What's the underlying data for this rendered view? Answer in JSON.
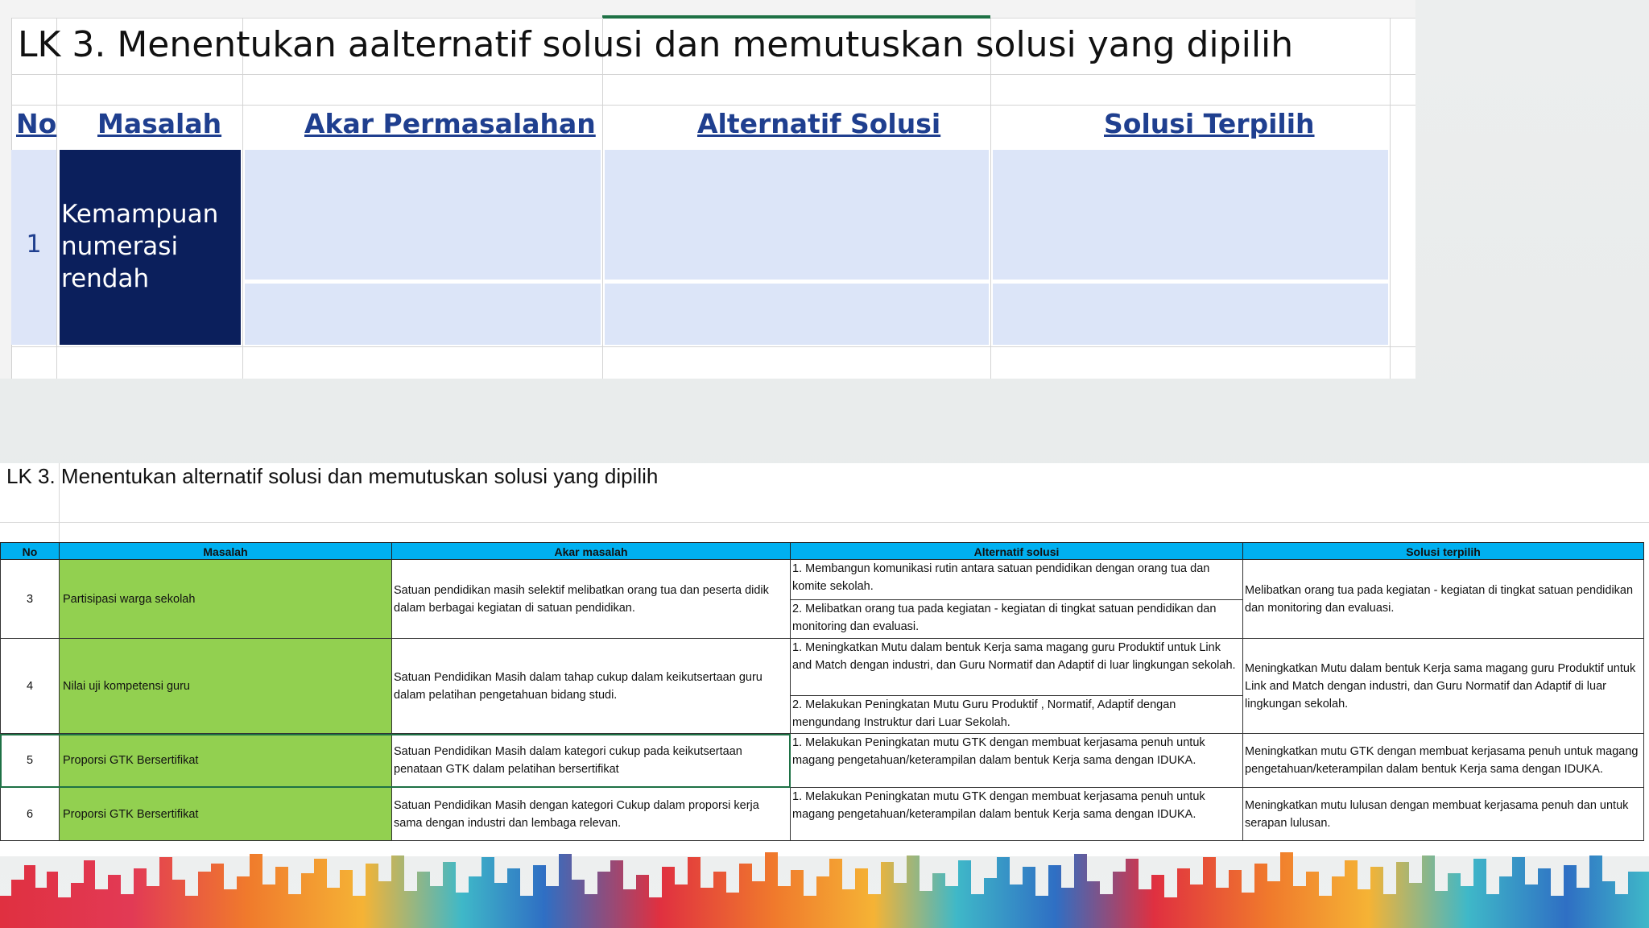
{
  "top_sheet": {
    "title": "LK 3. Menentukan aalternatif solusi dan memutuskan solusi yang dipilih",
    "headers": {
      "no": "No",
      "masalah": "Masalah",
      "akar": "Akar Permasalahan",
      "alternatif": "Alternatif Solusi",
      "terpilih": "Solusi Terpilih"
    },
    "row": {
      "no": "1",
      "masalah": "Kemampuan numerasi rendah"
    }
  },
  "bottom_sheet": {
    "title": "LK 3. Menentukan alternatif solusi dan memutuskan solusi yang dipilih",
    "headers": {
      "no": "No",
      "masalah": "Masalah",
      "akar": "Akar masalah",
      "alternatif": "Alternatif solusi",
      "terpilih": "Solusi terpilih"
    },
    "rows": [
      {
        "no": "3",
        "masalah": "Partisipasi warga sekolah",
        "akar": "Satuan pendidikan masih selektif melibatkan orang tua dan peserta didik dalam berbagai kegiatan di satuan pendidikan.",
        "alternatif": [
          "1. Membangun komunikasi rutin antara satuan pendidikan dengan orang tua dan komite sekolah.",
          "2. Melibatkan orang tua pada kegiatan - kegiatan di tingkat satuan pendidikan dan monitoring dan evaluasi."
        ],
        "terpilih": "Melibatkan orang tua pada kegiatan - kegiatan di tingkat satuan pendidikan dan monitoring dan evaluasi."
      },
      {
        "no": "4",
        "masalah": "Nilai uji kompetensi guru",
        "akar": "Satuan Pendidikan Masih dalam tahap cukup dalam keikutsertaan guru dalam pelatihan pengetahuan bidang studi.",
        "alternatif": [
          "1. Meningkatkan Mutu dalam bentuk Kerja sama magang guru Produktif untuk Link and Match dengan industri, dan Guru Normatif dan Adaptif di luar lingkungan sekolah.",
          "2. Melakukan Peningkatan Mutu Guru Produktif , Normatif, Adaptif dengan mengundang Instruktur dari Luar Sekolah."
        ],
        "terpilih": "Meningkatkan Mutu dalam bentuk Kerja sama magang guru Produktif untuk Link and Match dengan industri, dan Guru Normatif dan Adaptif di luar lingkungan sekolah."
      },
      {
        "no": "5",
        "masalah": "Proporsi GTK Bersertifikat",
        "akar": "Satuan Pendidikan Masih dalam kategori cukup pada keikutsertaan penataan GTK dalam pelatihan bersertifikat",
        "alternatif": [
          "1. Melakukan Peningkatan  mutu GTK dengan membuat kerjasama penuh untuk magang pengetahuan/keterampilan dalam bentuk Kerja sama dengan IDUKA."
        ],
        "terpilih": "Meningkatkan mutu GTK dengan membuat kerjasama penuh untuk magang pengetahuan/keterampilan dalam bentuk Kerja sama dengan IDUKA."
      },
      {
        "no": "6",
        "masalah": "Proporsi GTK Bersertifikat",
        "akar": "Satuan Pendidikan Masih dengan kategori Cukup dalam proporsi kerja sama dengan industri dan lembaga relevan.",
        "alternatif": [
          "1. Melakukan Peningkatan  mutu GTK dengan membuat kerjasama penuh untuk magang pengetahuan/keterampilan dalam bentuk Kerja sama dengan IDUKA."
        ],
        "terpilih": "Meningkatkan mutu lulusan dengan membuat kerjasama penuh dan untuk serapan lulusan."
      }
    ]
  },
  "colors": {
    "header_blue": "#00b0f0",
    "masalah_green": "#92d050",
    "navy": "#0b1f5c",
    "light_blue": "#dce5f8",
    "heading_text": "#1f3f8f"
  }
}
